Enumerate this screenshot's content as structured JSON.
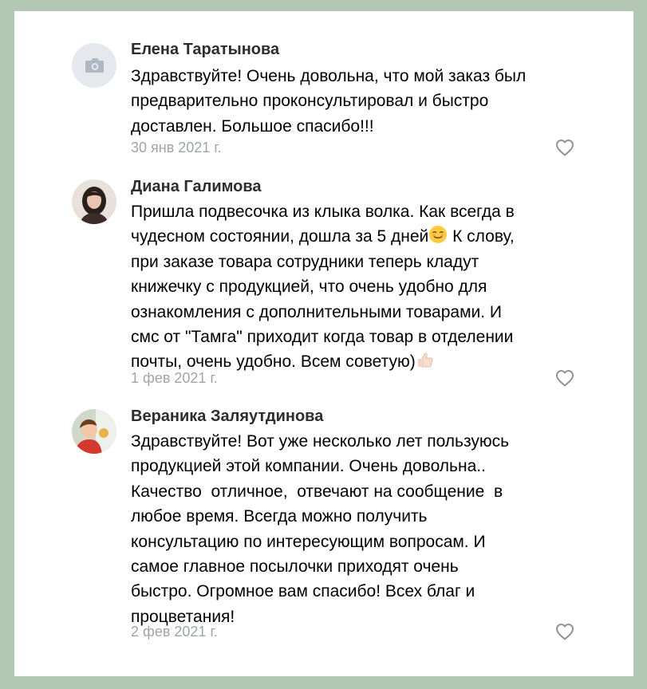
{
  "comments": [
    {
      "author": "Елена Таратынова",
      "lines": [
        "Здравствуйте! Очень довольна, что мой заказ был",
        "предварительно проконсультировал и быстро",
        "доставлен. Большое спасибо!!!"
      ],
      "date": "30 янв 2021 г.",
      "avatar_icon": "camera-icon"
    },
    {
      "author": "Диана Галимова",
      "lines": [
        "Пришла подвесочка из клыка волка. Как всегда в",
        "чудесном состоянии, дошла за 5 дней",
        " К слову,",
        "при заказе товара сотрудники теперь кладут",
        "книжечку с продукцией, что очень удобно для",
        "ознакомления с дополнительными товарами. И",
        "смс от \"Тамга\" приходит когда товар в отделении",
        "почты, очень удобно. Всем советую)"
      ],
      "date": "1 фев 2021 г.",
      "emojis": [
        "smiling-face-emoji",
        "thumbs-up-emoji"
      ]
    },
    {
      "author": "Вераника Заляутдинова",
      "lines": [
        "Здравствуйте! Вот уже несколько лет пользуюсь",
        "продукцией этой компании. Очень довольна..",
        "Качество  отличное,  отвечают на сообщение  в",
        "любое время. Всегда можно получить",
        "консультацию по интересующим вопросам. И",
        "самое главное посылочки приходят очень",
        "быстро. Огромное вам спасибо! Всех благ и",
        "процветания!"
      ],
      "date": "2 фев 2021 г."
    }
  ],
  "icons": {
    "like": "heart-outline-icon"
  },
  "colors": {
    "frame": "#b3c8b2",
    "author": "#2c2d2e",
    "date": "#a0a4a8",
    "like": "#8f9399"
  }
}
